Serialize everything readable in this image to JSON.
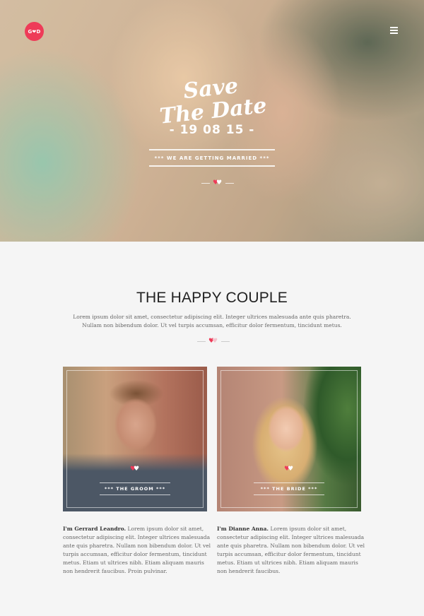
{
  "header": {
    "logo_text": "G❤D",
    "menu_icon": "hamburger-menu-icon"
  },
  "hero": {
    "title_line1": "Save",
    "title_line2": "The Date",
    "date": "- 19 08 15 -",
    "banner": "*** WE ARE GETTING MARRIED ***"
  },
  "couple": {
    "title": "THE HAPPY COUPLE",
    "intro": "Lorem ipsum dolor sit amet, consectetur adipiscing elit. Integer ultrices malesuada ante quis pharetra. Nullam non bibendum dolor. Ut vel turpis accumsan, efficitur dolor fermentum, tincidunt metus.",
    "groom": {
      "label": "*** THE GROOM ***",
      "name": "I'm Gerrard Leandro.",
      "bio": " Lorem ipsum dolor sit amet, consectetur adipiscing elit. Integer ultrices malesuada ante quis pharetra. Nullam non bibendum dolor. Ut vel turpis accumsan, efficitur dolor fermentum, tincidunt metus. Etiam ut ultrices nibh. Etiam aliquam mauris non hendrerit faucibus. Proin pulvinar."
    },
    "bride": {
      "label": "*** THE BRIDE ***",
      "name": "I'm Dianne Anna.",
      "bio": " Lorem ipsum dolor sit amet, consectetur adipiscing elit. Integer ultrices malesuada ante quis pharetra. Nullam non bibendum dolor. Ut vel turpis accumsan, efficitur dolor fermentum, tincidunt metus. Etiam ut ultrices nibh. Etiam aliquam mauris non hendrerit faucibus."
    }
  },
  "colors": {
    "accent": "#ee3b58",
    "background": "#f5f5f5",
    "text": "#666666",
    "heading": "#222222"
  }
}
